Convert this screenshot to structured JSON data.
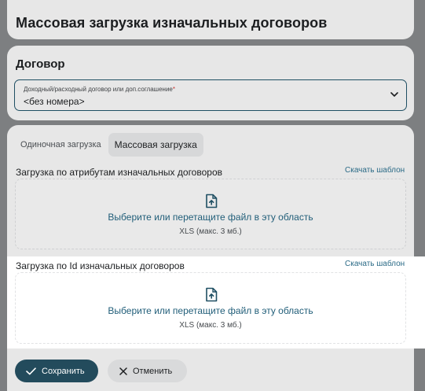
{
  "header": {
    "title": "Массовая загрузка изначальных договоров"
  },
  "contract": {
    "section_title": "Договор",
    "field_label": "Доходный/расходный договор или доп.соглашение",
    "required_mark": "*",
    "field_value": "<без номера>"
  },
  "tabs": [
    {
      "label": "Одиночная загрузка",
      "active": false
    },
    {
      "label": "Массовая загрузка",
      "active": true
    }
  ],
  "upload_blocks": [
    {
      "label": "Загрузка по атрибутам изначальных договоров",
      "link": "Скачать шаблон",
      "drop_text": "Выберите или перетащите файл в эту область",
      "hint": "XLS (макс. 3 мб.)"
    },
    {
      "label": "Загрузка по Id изначальных договоров",
      "link": "Скачать шаблон",
      "drop_text": "Выберите или перетащите файл в эту область",
      "hint": "XLS (макс. 3 мб.)"
    }
  ],
  "actions": {
    "save": "Сохранить",
    "cancel": "Отменить"
  },
  "colors": {
    "accent": "#234b5c",
    "link": "#2a6a86",
    "required": "#c63b36"
  },
  "icons": [
    "chevron-down-icon",
    "file-upload-icon",
    "check-icon",
    "close-icon"
  ]
}
